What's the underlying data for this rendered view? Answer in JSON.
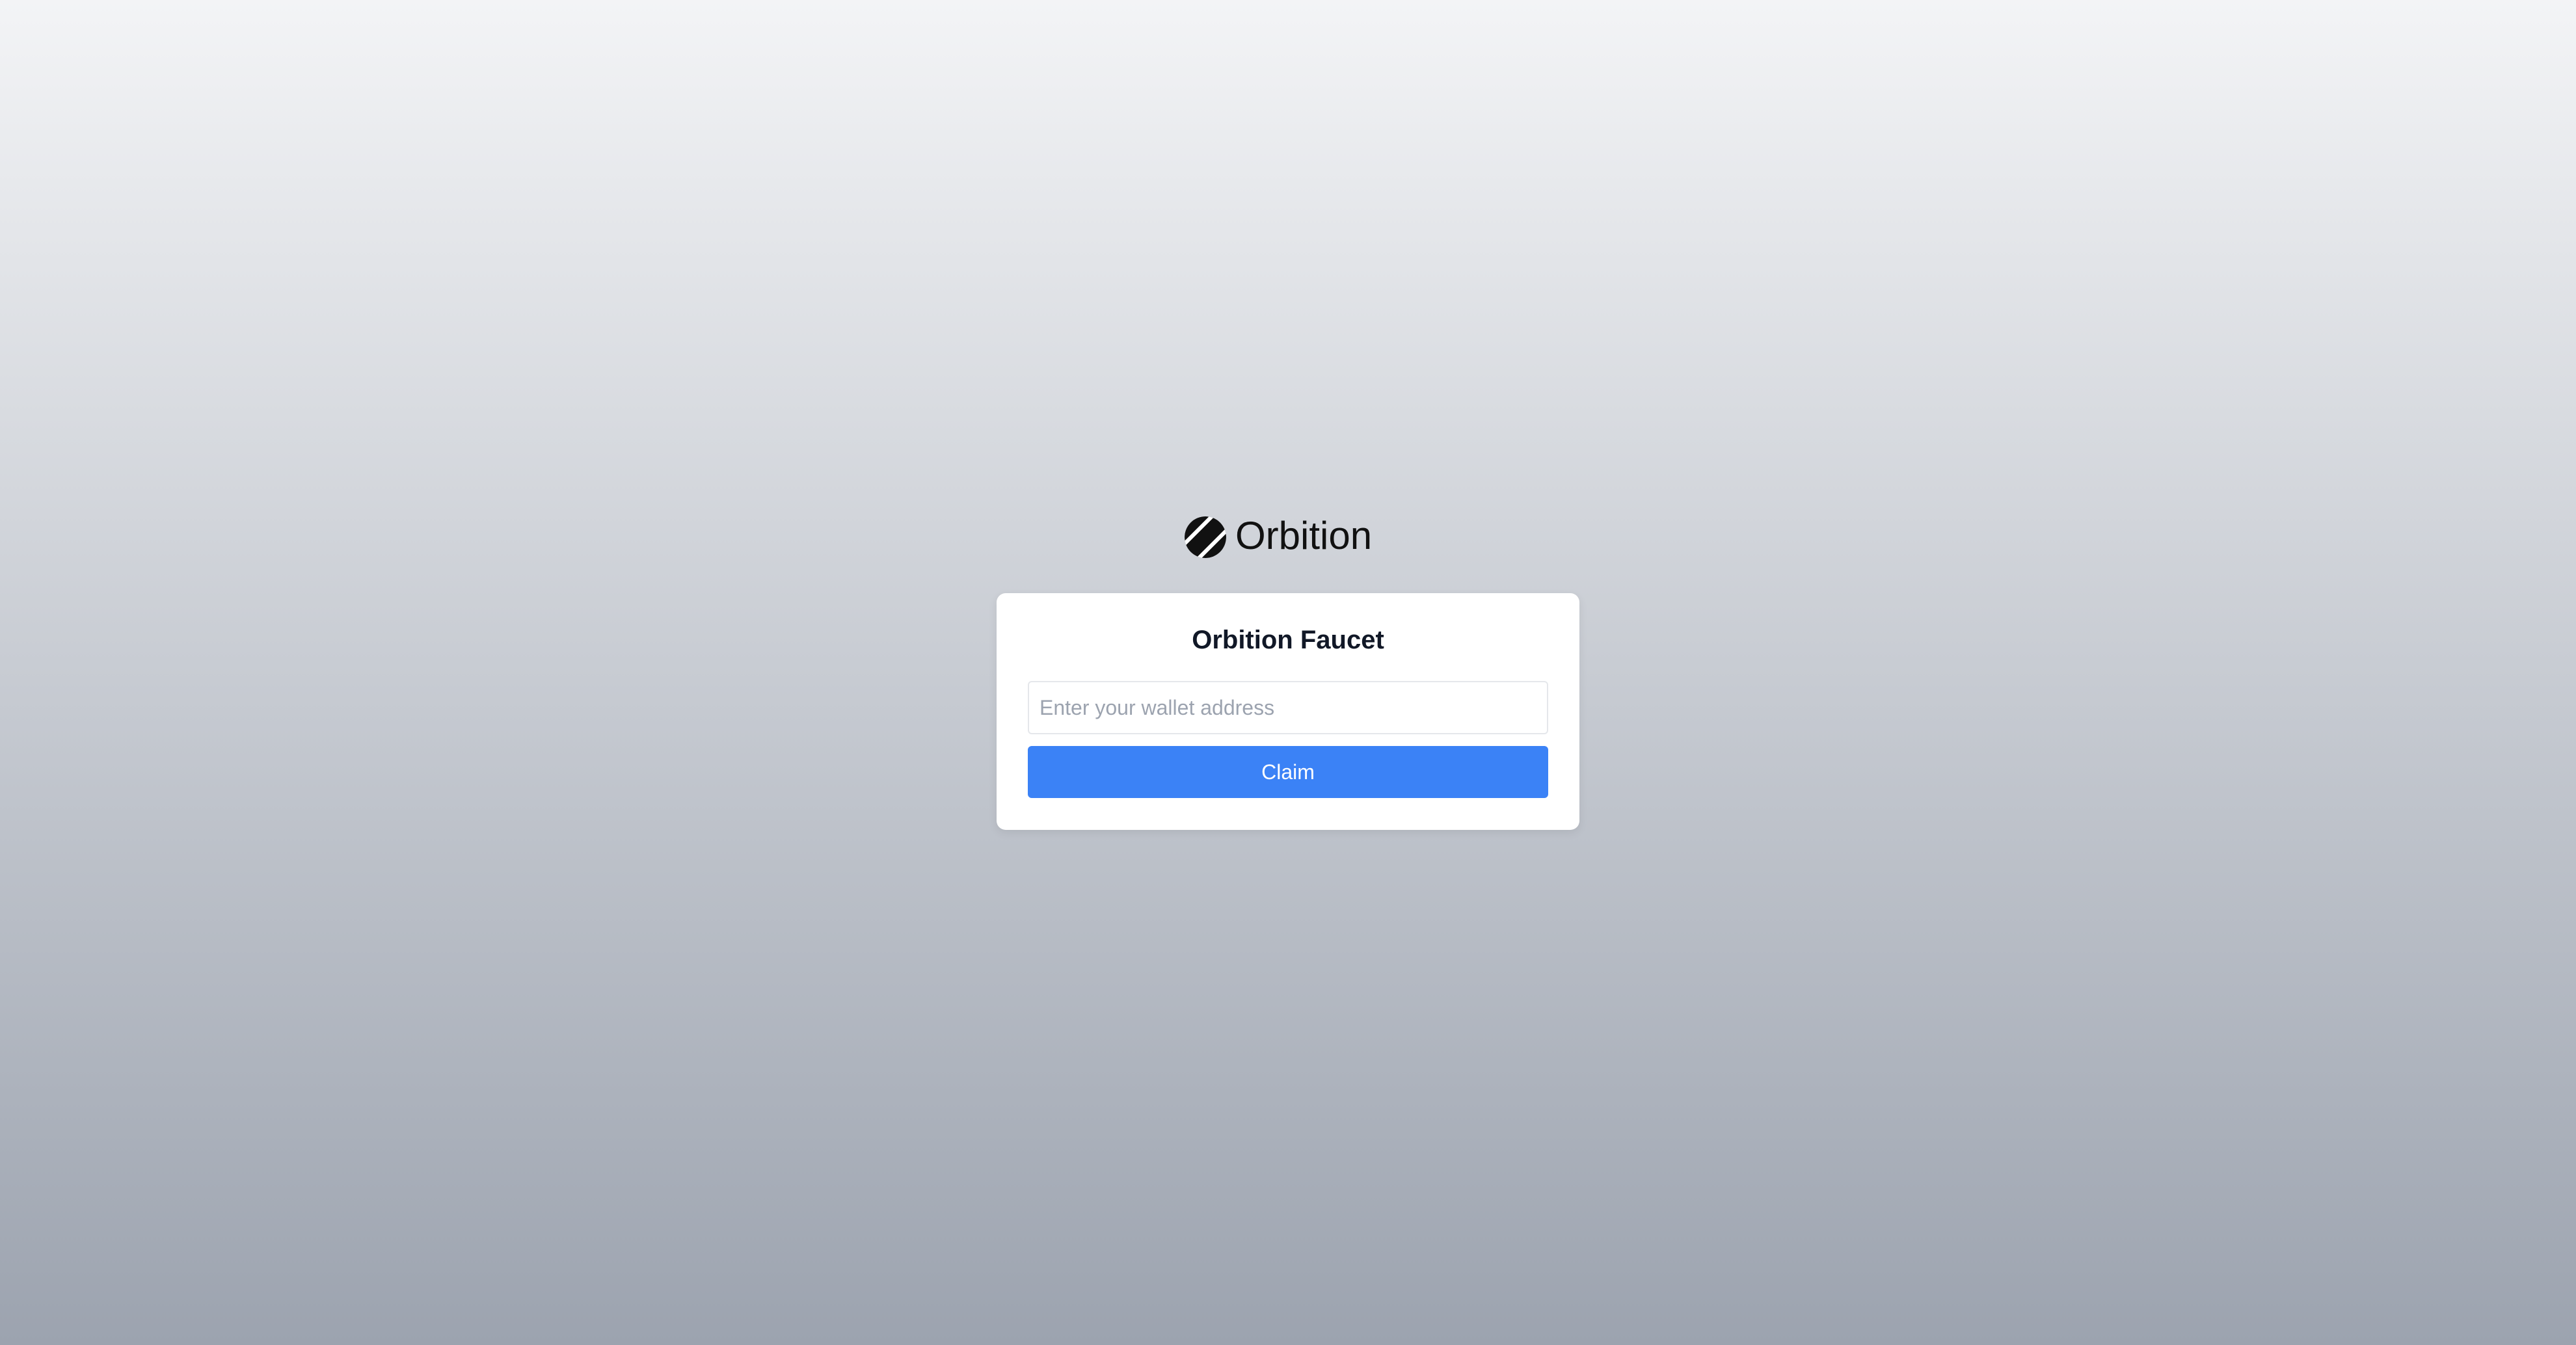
{
  "brand": {
    "name": "Orbition",
    "logo_icon": "orbition-logo-icon"
  },
  "card": {
    "title": "Orbition Faucet"
  },
  "wallet_input": {
    "value": "",
    "placeholder": "Enter your wallet address"
  },
  "claim_button": {
    "label": "Claim"
  },
  "colors": {
    "accent": "#3b82f6",
    "background_top": "#f3f4f6",
    "background_bottom": "#9ca3af",
    "card": "#ffffff",
    "text": "#111827"
  }
}
